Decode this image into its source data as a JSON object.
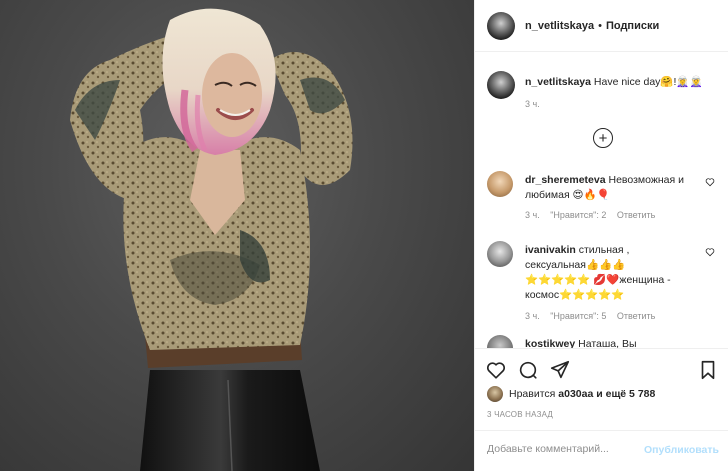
{
  "post": {
    "image_alt": "Photo of a woman with blonde and pink hair wearing a patterned blouse and black leather pants"
  },
  "header": {
    "username": "n_vetlitskaya",
    "separator": "•",
    "follow_label": "Подписки",
    "avatar_icon": "profile-avatar"
  },
  "caption": {
    "username": "n_vetlitskaya",
    "text": "Have nice day🤗!🧝‍♀️🧝‍♀️",
    "time": "3 ч."
  },
  "load_more_icon": "plus-circle-icon",
  "comments": [
    {
      "username": "dr_sheremeteva",
      "text": "Невозможная и любимая 😍🔥🎈",
      "time": "3 ч.",
      "likes": "\"Нравится\": 2",
      "reply": "Ответить"
    },
    {
      "username": "ivanivakin",
      "text": "стильная , сексуальная👍👍👍⭐⭐⭐⭐⭐ 💋❤️женщина - космос⭐⭐⭐⭐⭐",
      "time": "3 ч.",
      "likes": "\"Нравится\": 5",
      "reply": "Ответить"
    },
    {
      "username": "kostikwey",
      "text": "Наташа, Вы",
      "time": "",
      "likes": "",
      "reply": ""
    }
  ],
  "actions": {
    "like_icon": "heart-icon",
    "comment_icon": "comment-icon",
    "share_icon": "share-icon",
    "save_icon": "bookmark-icon"
  },
  "likes": {
    "prefix": "Нравится",
    "user": "a030aa",
    "suffix": "и ещё 5 788"
  },
  "time_ago": "3 ЧАСОВ НАЗАД",
  "add_comment": {
    "placeholder": "Добавьте комментарий...",
    "post_label": "Опубликовать"
  },
  "colors": {
    "border": "#efefef",
    "muted": "#8e8e8e",
    "text": "#262626",
    "post_disabled": "#b2dffc"
  }
}
